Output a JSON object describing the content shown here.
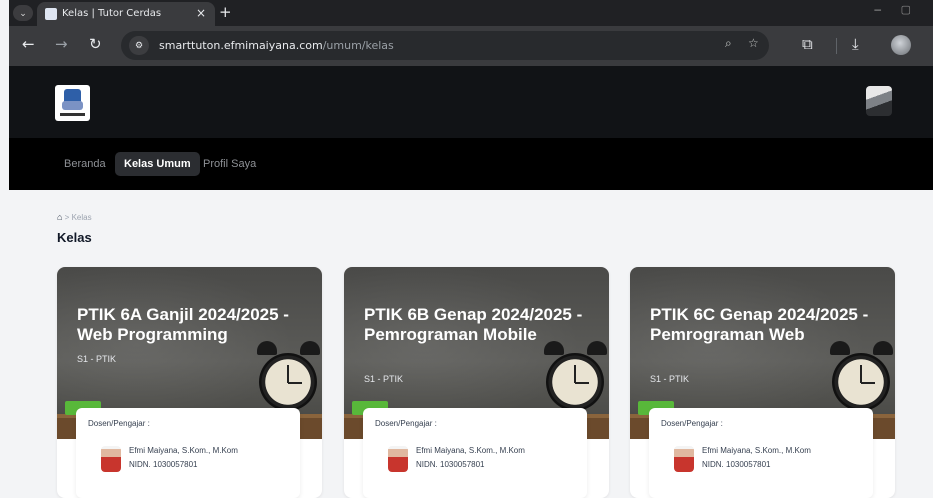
{
  "browser": {
    "tab_title": "Kelas | Tutor Cerdas",
    "tab_close": "×",
    "new_tab": "+",
    "url_host": "smarttuton.efmimaiyana.com",
    "url_path": "/umum/kelas"
  },
  "icons": {
    "tab_list": "⌄",
    "minimize": "–",
    "maximize": "▢",
    "back": "←",
    "forward": "→",
    "reload": "↻",
    "site_settings": "⚙",
    "zoom": "⌕",
    "bookmark": "☆",
    "extensions": "⧉",
    "download": "⤓",
    "home": "⌂",
    "tab_list_name": "chevron-down-icon"
  },
  "nav": {
    "items": [
      "Beranda",
      "Kelas Umum",
      "Profil Saya"
    ],
    "active": "Kelas Umum"
  },
  "breadcrumb": {
    "separator": ">",
    "current": "Kelas"
  },
  "page_title": "Kelas",
  "colors": {
    "topbar": "#111316",
    "navbar": "#000000",
    "active_nav": "#2b2d31",
    "content_bg": "#f3f4f6"
  },
  "cards": [
    {
      "title": "PTIK 6A Ganjil 2024/2025 - Web Programming",
      "subtitle": "S1 - PTIK",
      "teacher_label": "Dosen/Pengajar :",
      "teacher_name": "Efmi Maiyana, S.Kom., M.Kom",
      "teacher_nidn": "NIDN. 1030057801"
    },
    {
      "title": "PTIK 6B Genap 2024/2025 - Pemrograman Mobile",
      "subtitle": "S1 - PTIK",
      "teacher_label": "Dosen/Pengajar :",
      "teacher_name": "Efmi Maiyana, S.Kom., M.Kom",
      "teacher_nidn": "NIDN. 1030057801"
    },
    {
      "title": "PTIK 6C Genap 2024/2025 - Pemrograman Web",
      "subtitle": "S1 - PTIK",
      "teacher_label": "Dosen/Pengajar :",
      "teacher_name": "Efmi Maiyana, S.Kom., M.Kom",
      "teacher_nidn": "NIDN. 1030057801"
    }
  ]
}
